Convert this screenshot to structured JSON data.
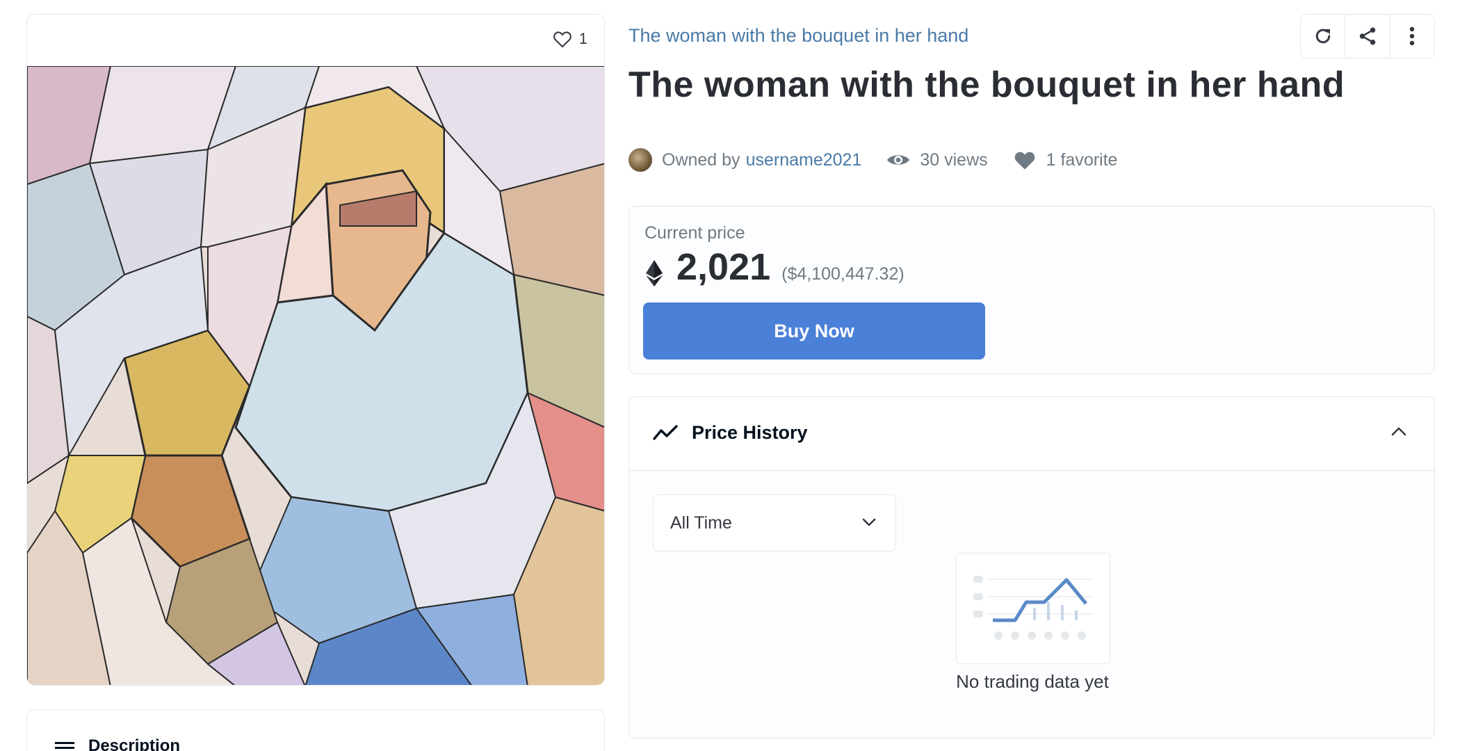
{
  "asset": {
    "collection_name": "The woman with the bouquet in her hand",
    "title": "The woman with the bouquet in her hand",
    "favorite_count": "1",
    "owned_by_label": "Owned by",
    "owner": "username2021",
    "views": "30 views",
    "favorites": "1 favorite"
  },
  "toolbar": {
    "icons": [
      "refresh-icon",
      "share-icon",
      "more-vertical-icon"
    ]
  },
  "price": {
    "label": "Current price",
    "value": "2,021",
    "usd": "($4,100,447.32)",
    "buy_label": "Buy Now"
  },
  "price_history": {
    "title": "Price History",
    "range_selected": "All Time",
    "empty_message": "No trading data yet"
  },
  "description": {
    "title": "Description"
  },
  "colors": {
    "accent": "#4a80d8",
    "link": "#4a7aa7",
    "border": "#e5e8eb"
  }
}
